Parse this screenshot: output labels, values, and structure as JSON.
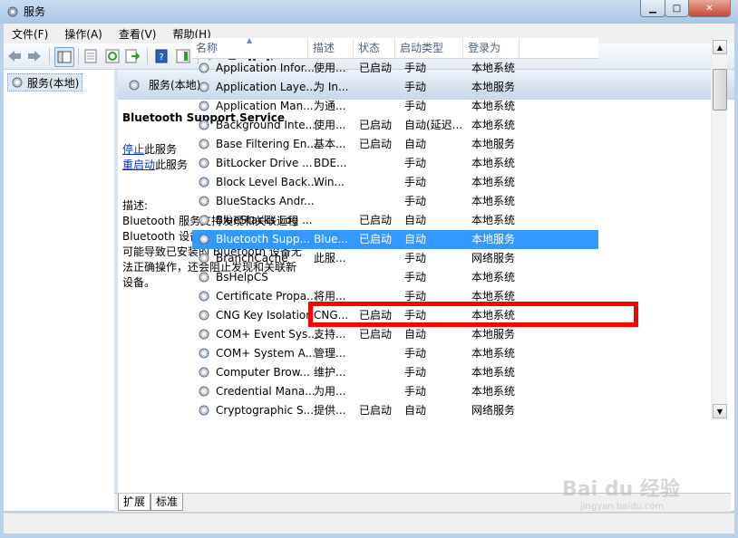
{
  "window": {
    "title": "服务"
  },
  "menu": [
    "文件(F)",
    "操作(A)",
    "查看(V)",
    "帮助(H)"
  ],
  "tree": {
    "root": "服务(本地)"
  },
  "panel": {
    "header": "服务(本地)"
  },
  "detail": {
    "service_name": "Bluetooth Support Service",
    "stop_link": "停止",
    "stop_suffix": "此服务",
    "restart_link": "重启动",
    "restart_suffix": "此服务",
    "desc_label": "描述:",
    "desc_lines": [
      "Bluetooth 服务支持发现和关联远程",
      "Bluetooth 设备。停止或禁用此服务",
      "可能导致已安装的 Bluetooth 设备无",
      "法正确操作，还会阻止发现和关联新",
      "设备。"
    ]
  },
  "columns": [
    "名称",
    "描述",
    "状态",
    "启动类型",
    "登录为"
  ],
  "rows": [
    [
      "Application Infor...",
      "使用...",
      "已启动",
      "手动",
      "本地系统"
    ],
    [
      "Application Laye...",
      "为 In...",
      "",
      "手动",
      "本地服务"
    ],
    [
      "Application Man...",
      "为通...",
      "",
      "手动",
      "本地系统"
    ],
    [
      "Background Inte...",
      "使用...",
      "已启动",
      "自动(延迟...",
      "本地系统"
    ],
    [
      "Base Filtering En...",
      "基本...",
      "已启动",
      "自动",
      "本地服务"
    ],
    [
      "BitLocker Drive ...",
      "BDE...",
      "",
      "手动",
      "本地系统"
    ],
    [
      "Block Level Back...",
      "Win...",
      "",
      "手动",
      "本地系统"
    ],
    [
      "BlueStacks Andr...",
      "",
      "",
      "手动",
      "本地系统"
    ],
    [
      "BlueStacks Log ...",
      "",
      "已启动",
      "自动",
      "本地系统"
    ],
    [
      "Bluetooth Supp...",
      "Blue...",
      "已启动",
      "自动",
      "本地服务"
    ],
    [
      "BranchCache",
      "此服...",
      "",
      "手动",
      "网络服务"
    ],
    [
      "BsHelpCS",
      "",
      "",
      "手动",
      "本地系统"
    ],
    [
      "Certificate Propa...",
      "将用...",
      "",
      "手动",
      "本地系统"
    ],
    [
      "CNG Key Isolation",
      "CNG...",
      "已启动",
      "手动",
      "本地系统"
    ],
    [
      "COM+ Event Sys...",
      "支持...",
      "已启动",
      "自动",
      "本地服务"
    ],
    [
      "COM+ System A...",
      "管理...",
      "",
      "手动",
      "本地系统"
    ],
    [
      "Computer Brow...",
      "维护...",
      "",
      "手动",
      "本地系统"
    ],
    [
      "Credential Mana...",
      "为用...",
      "",
      "手动",
      "本地系统"
    ],
    [
      "Cryptographic S...",
      "提供...",
      "已启动",
      "自动",
      "网络服务"
    ]
  ],
  "selected_row": 9,
  "tabs": [
    "扩展",
    "标准"
  ],
  "watermark": {
    "brand": "Bai du 经验",
    "url": "jingyan.baidu.com"
  },
  "colors": {
    "selection": "#3399ff",
    "highlight_box": "#ff0000",
    "link": "#0033cc"
  }
}
